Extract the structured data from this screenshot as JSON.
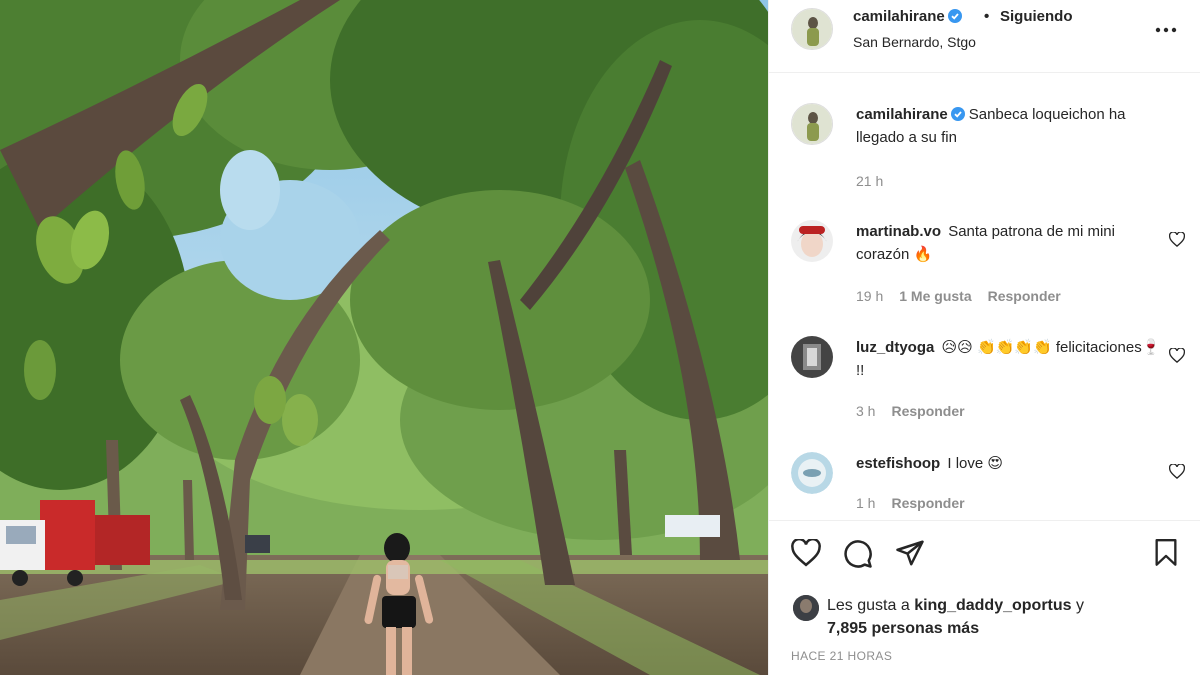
{
  "post": {
    "author": "camilahirane",
    "follow_status": "Siguiendo",
    "location": "San Bernardo, Stgo",
    "more_icon": "more-options-icon",
    "caption_author": "camilahirane",
    "caption": "Sanbeca loqueichon ha llegado a su fin",
    "caption_time": "21 h"
  },
  "comments": [
    {
      "user": "martinab.vo",
      "text": "Santa patrona de mi mini corazón 🔥",
      "time": "19 h",
      "likes": "1 Me gusta",
      "reply": "Responder"
    },
    {
      "user": "luz_dtyoga",
      "text": "😥😥 👏👏👏👏 felicitaciones🍷 !!",
      "time": "3 h",
      "reply": "Responder"
    },
    {
      "user": "estefishoop",
      "text": "I love 😍",
      "time": "1 h",
      "reply": "Responder"
    }
  ],
  "likes": {
    "prefix": "Les gusta a",
    "user": "king_daddy_oportus",
    "conj": "y",
    "count": "7,895 personas más"
  },
  "posted_ago": "HACE 21 HORAS",
  "colors": {
    "verified": "#3897f0",
    "text": "#262626",
    "muted": "#8e8e8e",
    "border": "#efefef"
  }
}
